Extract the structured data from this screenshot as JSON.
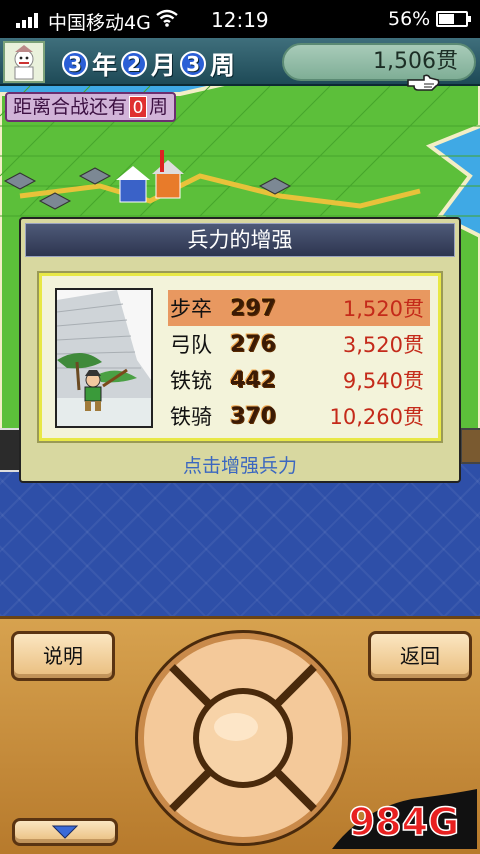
{
  "status_bar": {
    "carrier": "中国移动4G",
    "time": "12:19",
    "battery": "56%",
    "battery_level": 0.56
  },
  "header": {
    "year": "3",
    "year_unit": "年",
    "month": "2",
    "month_unit": "月",
    "week": "3",
    "week_unit": "周",
    "gold": "1,506贯"
  },
  "countdown": {
    "prefix": "距离合战还有",
    "number": "0",
    "suffix": "周"
  },
  "dialog": {
    "title": "兵力的增强",
    "hint": "点击增强兵力",
    "troops": [
      {
        "name": "步卒",
        "count": "297",
        "price": "1,520贯",
        "selected": true
      },
      {
        "name": "弓队",
        "count": "276",
        "price": "3,520贯",
        "selected": false
      },
      {
        "name": "铁铳",
        "count": "442",
        "price": "9,540贯",
        "selected": false
      },
      {
        "name": "铁骑",
        "count": "370",
        "price": "10,260贯",
        "selected": false
      }
    ]
  },
  "controls": {
    "help_label": "说明",
    "back_label": "返回"
  },
  "watermark": "984G"
}
